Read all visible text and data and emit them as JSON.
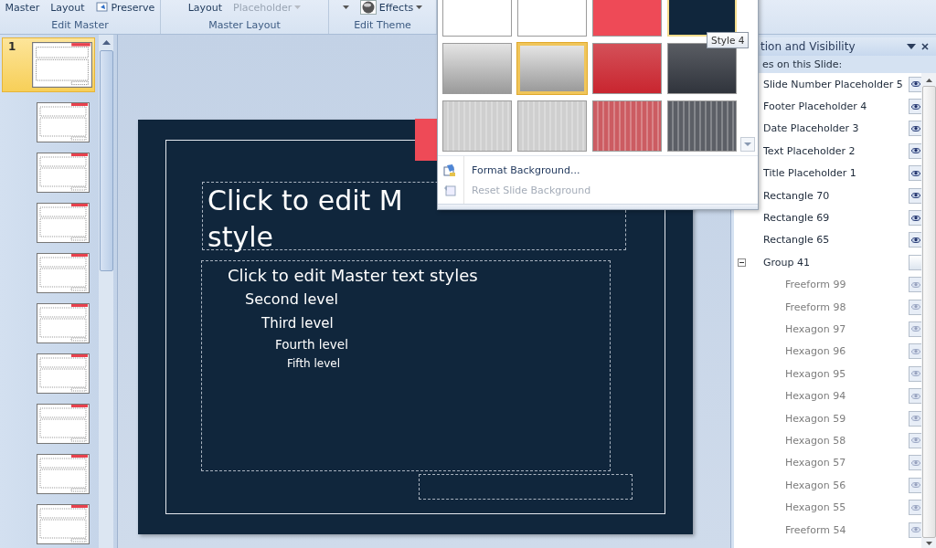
{
  "ribbon": {
    "groups": [
      {
        "label": "Edit Master",
        "items": [
          {
            "kind": "button",
            "label": "Master",
            "disabled": false
          },
          {
            "kind": "button",
            "label": "Layout",
            "disabled": false
          },
          {
            "kind": "icon-button",
            "label": "Preserve",
            "disabled": false
          }
        ]
      },
      {
        "label": "Master Layout",
        "items": [
          {
            "kind": "button",
            "label": "Layout",
            "disabled": false
          },
          {
            "kind": "dropdown",
            "label": "Placeholder",
            "disabled": true
          }
        ]
      },
      {
        "label": "Edit Theme",
        "items": [
          {
            "kind": "caret",
            "disabled": false
          },
          {
            "kind": "icon-dropdown",
            "label": "Effects",
            "disabled": false
          }
        ]
      }
    ]
  },
  "thumbnails": [
    {
      "number": "1",
      "selected": true
    },
    {
      "selected": false
    },
    {
      "selected": false
    },
    {
      "selected": false
    },
    {
      "selected": false
    },
    {
      "selected": false
    },
    {
      "selected": false
    },
    {
      "selected": false
    },
    {
      "selected": false
    },
    {
      "selected": false
    }
  ],
  "slide": {
    "title_lines": [
      "Click to edit M",
      "style"
    ],
    "text_levels": [
      "Click to edit Master text styles",
      "Second level",
      "Third level",
      "Fourth level",
      "Fifth level"
    ]
  },
  "background_styles": {
    "swatches": [
      {
        "kind": "solid",
        "color": "#ffffff",
        "selected": false,
        "hovered": false
      },
      {
        "kind": "solid",
        "color": "#ffffff",
        "selected": false,
        "hovered": false
      },
      {
        "kind": "solid",
        "color": "#ee4a57",
        "selected": false,
        "hovered": false
      },
      {
        "kind": "solid",
        "color": "#10263c",
        "selected": false,
        "hovered": true
      },
      {
        "kind": "gradient",
        "color": "#9a9a9a",
        "selected": false,
        "hovered": false
      },
      {
        "kind": "gradient",
        "color": "#9a9a9a",
        "selected": true,
        "hovered": false
      },
      {
        "kind": "gradient",
        "color": "#c9252f",
        "selected": false,
        "hovered": false
      },
      {
        "kind": "gradient",
        "color": "#30343c",
        "selected": false,
        "hovered": false
      },
      {
        "kind": "stripes",
        "color": "#cfcfcf",
        "selected": false,
        "hovered": false
      },
      {
        "kind": "stripes",
        "color": "#cfcfcf",
        "selected": false,
        "hovered": false
      },
      {
        "kind": "stripes",
        "color": "#cc5c62",
        "selected": false,
        "hovered": false
      },
      {
        "kind": "stripes",
        "color": "#5c5f66",
        "selected": false,
        "hovered": false
      }
    ],
    "tooltip": "Style 4",
    "menu": [
      {
        "label": "Format Background...",
        "disabled": false
      },
      {
        "label": "Reset Slide Background",
        "disabled": true
      }
    ]
  },
  "selection_pane": {
    "title": "tion and Visibility",
    "subtitle": "es on this Slide:",
    "shapes": [
      {
        "name": "Slide Number Placeholder 5",
        "visible": true
      },
      {
        "name": "Footer Placeholder 4",
        "visible": true
      },
      {
        "name": "Date Placeholder 3",
        "visible": true
      },
      {
        "name": "Text Placeholder 2",
        "visible": true
      },
      {
        "name": "Title Placeholder 1",
        "visible": true
      },
      {
        "name": "Rectangle 70",
        "visible": true
      },
      {
        "name": "Rectangle 69",
        "visible": true
      },
      {
        "name": "Rectangle 65",
        "visible": true
      },
      {
        "name": "Group 41",
        "visible": false,
        "expanded": true,
        "children": [
          {
            "name": "Freeform 99",
            "visible": true
          },
          {
            "name": "Freeform 98",
            "visible": true
          },
          {
            "name": "Hexagon 97",
            "visible": true
          },
          {
            "name": "Hexagon 96",
            "visible": true
          },
          {
            "name": "Hexagon 95",
            "visible": true
          },
          {
            "name": "Hexagon 94",
            "visible": true
          },
          {
            "name": "Hexagon 59",
            "visible": true
          },
          {
            "name": "Hexagon 58",
            "visible": true
          },
          {
            "name": "Hexagon 57",
            "visible": true
          },
          {
            "name": "Hexagon 56",
            "visible": true
          },
          {
            "name": "Hexagon 55",
            "visible": true
          },
          {
            "name": "Freeform 54",
            "visible": true
          }
        ]
      }
    ]
  }
}
